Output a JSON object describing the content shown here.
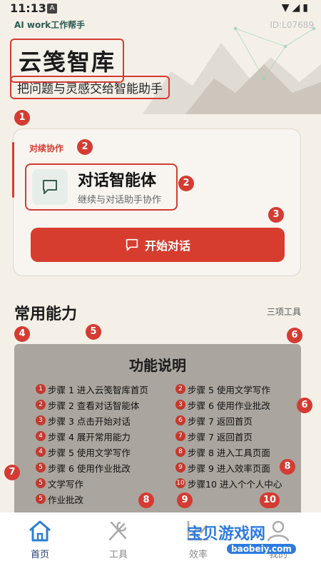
{
  "status_bar": {
    "time": "11:13"
  },
  "header": {
    "brand_sub": "AI work工作帮手",
    "user_id": "ID:L07689",
    "title": "云笺智库",
    "tagline": "把问题与灵感交给智能助手"
  },
  "badges": [
    "1",
    "2",
    "2",
    "3",
    "4",
    "5",
    "6",
    "6",
    "7",
    "8",
    "8",
    "9",
    "10"
  ],
  "card": {
    "section_label": "对续协作",
    "agent_name": "对话智能体",
    "agent_desc": "继续与对话助手协作",
    "start_button": "开始对话"
  },
  "capabilities": {
    "title": "常用能力",
    "count": "三项工具"
  },
  "overlay": {
    "title": "功能说明",
    "left_steps": [
      {
        "n": "1",
        "text": "步骤 1 进入云笺智库首页"
      },
      {
        "n": "2",
        "text": "步骤 2 查看对话智能体"
      },
      {
        "n": "3",
        "text": "步骤 3 点击开始对话"
      },
      {
        "n": "4",
        "text": "步骤 4 展开常用能力"
      },
      {
        "n": "4",
        "text": "步骤 5 使用文学写作"
      },
      {
        "n": "5",
        "text": "步骤 6 使用作业批改"
      },
      {
        "n": "5",
        "text": "文学写作"
      },
      {
        "n": "5",
        "text": "作业批改"
      }
    ],
    "right_steps": [
      {
        "n": "2",
        "text": "步骤 5 使用文学写作"
      },
      {
        "n": "3",
        "text": "步骤 6 使用作业批改"
      },
      {
        "n": "6",
        "text": "步骤 7 返回首页"
      },
      {
        "n": "7",
        "text": "步骤 7 返回首页"
      },
      {
        "n": "8",
        "text": "步骤 8 进入工具页面"
      },
      {
        "n": "9",
        "text": "步骤 9 进入效率页面"
      },
      {
        "n": "10",
        "text": "步骤10 进入个个人中心"
      }
    ]
  },
  "nav": {
    "items": [
      {
        "label": "首页",
        "icon": "home-icon"
      },
      {
        "label": "工具",
        "icon": "tools-icon"
      },
      {
        "label": "效率",
        "icon": "chart-icon"
      },
      {
        "label": "我的",
        "icon": "user-icon"
      }
    ]
  },
  "watermark": {
    "main": "宝贝游戏网",
    "sub": "baobeiy.com"
  },
  "colors": {
    "accent": "#d43b32",
    "background": "#f4f0e8",
    "nav_active": "#1f3f70"
  }
}
